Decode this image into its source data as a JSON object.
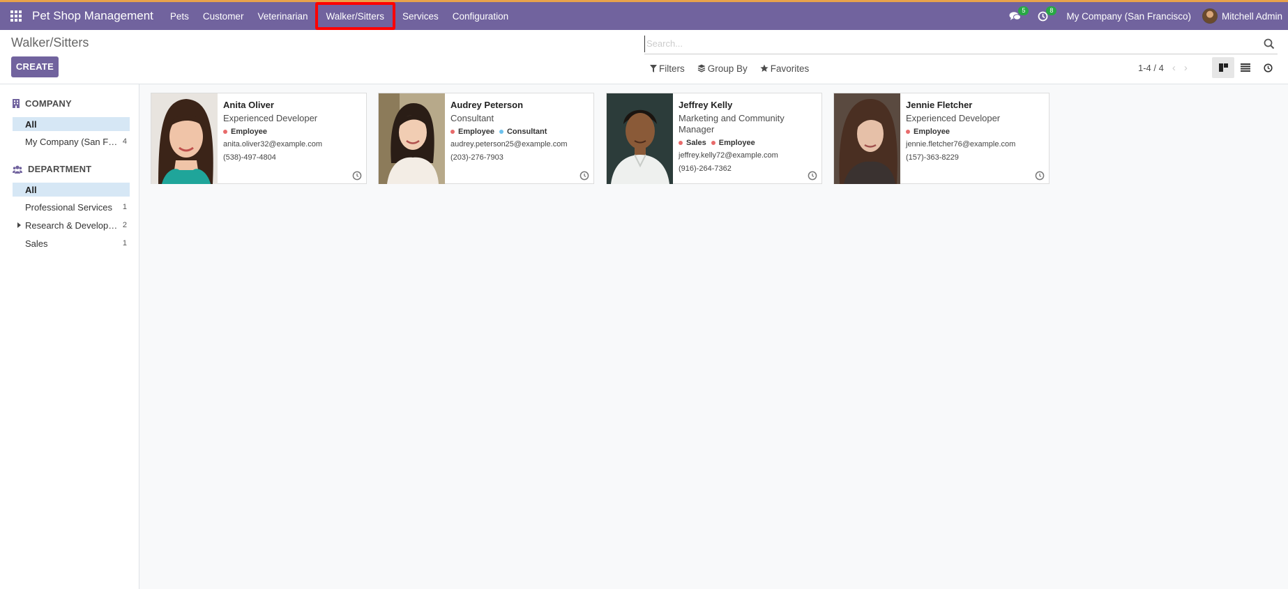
{
  "navbar": {
    "app_name": "Pet Shop Management",
    "menu": [
      {
        "label": "Pets"
      },
      {
        "label": "Customer"
      },
      {
        "label": "Veterinarian"
      },
      {
        "label": "Walker/Sitters"
      },
      {
        "label": "Services"
      },
      {
        "label": "Configuration"
      }
    ],
    "messages_count": "5",
    "activities_count": "8",
    "company": "My Company (San Francisco)",
    "user": "Mitchell Admin",
    "color": "#71639e"
  },
  "control_panel": {
    "breadcrumb": "Walker/Sitters",
    "create_label": "CREATE",
    "search_placeholder": "Search...",
    "filters_label": "Filters",
    "group_by_label": "Group By",
    "favorites_label": "Favorites",
    "pager": "1-4 / 4"
  },
  "sidepanel": {
    "company": {
      "title": "COMPANY",
      "items": [
        {
          "label": "All",
          "count": ""
        },
        {
          "label": "My Company (San Fr…",
          "count": "4"
        }
      ]
    },
    "department": {
      "title": "DEPARTMENT",
      "items": [
        {
          "label": "All",
          "count": ""
        },
        {
          "label": "Professional Services",
          "count": "1"
        },
        {
          "label": "Research & Develop…",
          "count": "2"
        },
        {
          "label": "Sales",
          "count": "1"
        }
      ]
    }
  },
  "cards": [
    {
      "name": "Anita Oliver",
      "job": "Experienced Developer",
      "tags": [
        {
          "label": "Employee",
          "color": "#e86b6b"
        }
      ],
      "email": "anita.oliver32@example.com",
      "phone": "(538)-497-4804"
    },
    {
      "name": "Audrey Peterson",
      "job": "Consultant",
      "tags": [
        {
          "label": "Employee",
          "color": "#e86b6b"
        },
        {
          "label": "Consultant",
          "color": "#6cc1ed"
        }
      ],
      "email": "audrey.peterson25@example.com",
      "phone": "(203)-276-7903"
    },
    {
      "name": "Jeffrey Kelly",
      "job": "Marketing and Community Manager",
      "tags": [
        {
          "label": "Sales",
          "color": "#e86b6b"
        },
        {
          "label": "Employee",
          "color": "#e86b6b"
        }
      ],
      "email": "jeffrey.kelly72@example.com",
      "phone": "(916)-264-7362"
    },
    {
      "name": "Jennie Fletcher",
      "job": "Experienced Developer",
      "tags": [
        {
          "label": "Employee",
          "color": "#e86b6b"
        }
      ],
      "email": "jennie.fletcher76@example.com",
      "phone": "(157)-363-8229"
    }
  ]
}
